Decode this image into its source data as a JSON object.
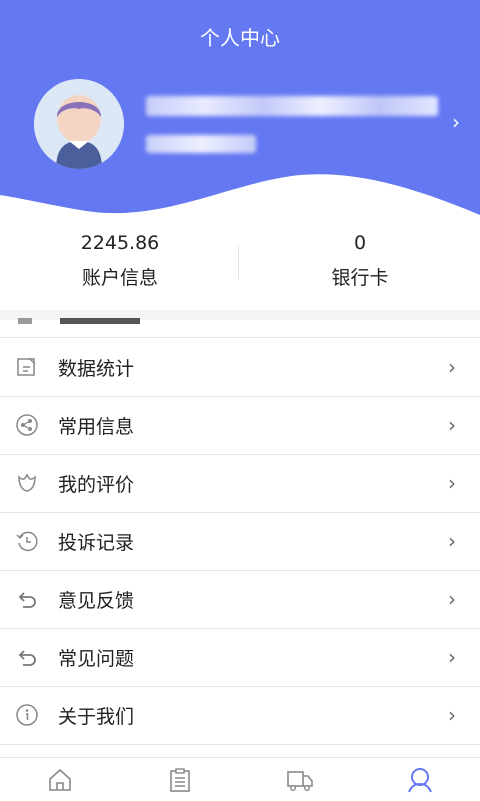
{
  "header": {
    "title": "个人中心",
    "bg_color": "#6478f2"
  },
  "stats": [
    {
      "value": "2245.86",
      "label": "账户信息"
    },
    {
      "value": "0",
      "label": "银行卡"
    }
  ],
  "menu": [
    {
      "label": "数据统计",
      "icon": "edit-icon"
    },
    {
      "label": "常用信息",
      "icon": "share-icon"
    },
    {
      "label": "我的评价",
      "icon": "flower-icon"
    },
    {
      "label": "投诉记录",
      "icon": "history-icon"
    },
    {
      "label": "意见反馈",
      "icon": "undo-icon"
    },
    {
      "label": "常见问题",
      "icon": "undo-icon"
    },
    {
      "label": "关于我们",
      "icon": "info-icon"
    }
  ],
  "tabbar": {
    "items": [
      "home-icon",
      "clipboard-icon",
      "truck-icon",
      "user-icon"
    ],
    "active_color": "#6478f2"
  }
}
